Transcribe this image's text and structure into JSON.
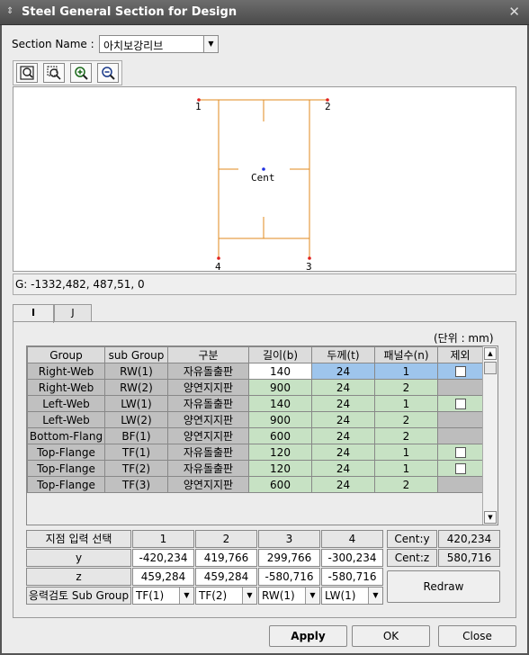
{
  "window": {
    "title": "Steel General Section for Design",
    "icon": "chevron-updown-icon",
    "close": "✕"
  },
  "section": {
    "label": "Section Name :",
    "value": "아치보강리브"
  },
  "toolbar": {
    "icons": [
      "zoom-fit-icon",
      "zoom-window-icon",
      "zoom-in-icon",
      "zoom-out-icon"
    ]
  },
  "drawing": {
    "points": [
      "1",
      "2",
      "3",
      "4"
    ],
    "center_label": "Cent",
    "line_color": "#e08a1e",
    "point_color": "#e02020",
    "center_color": "#2030e0"
  },
  "status": {
    "text": "G: -1332,482, 487,51, 0"
  },
  "tabs": [
    {
      "label": "I",
      "active": true
    },
    {
      "label": "J",
      "active": false
    }
  ],
  "unit_label": "(단위 : mm)",
  "table": {
    "headers": [
      "Group",
      "sub Group",
      "구분",
      "길이(b)",
      "두께(t)",
      "패널수(n)",
      "제외"
    ],
    "rows": [
      {
        "group": "Right-Web",
        "sub": "RW(1)",
        "kind": "자유돌출판",
        "b": "140",
        "t": "24",
        "n": "1",
        "ex": true
      },
      {
        "group": "Right-Web",
        "sub": "RW(2)",
        "kind": "양연지지판",
        "b": "900",
        "t": "24",
        "n": "2",
        "ex": false
      },
      {
        "group": "Left-Web",
        "sub": "LW(1)",
        "kind": "자유돌출판",
        "b": "140",
        "t": "24",
        "n": "1",
        "ex": true
      },
      {
        "group": "Left-Web",
        "sub": "LW(2)",
        "kind": "양연지지판",
        "b": "900",
        "t": "24",
        "n": "2",
        "ex": false
      },
      {
        "group": "Bottom-Flang",
        "sub": "BF(1)",
        "kind": "양연지지판",
        "b": "600",
        "t": "24",
        "n": "2",
        "ex": false
      },
      {
        "group": "Top-Flange",
        "sub": "TF(1)",
        "kind": "자유돌출판",
        "b": "120",
        "t": "24",
        "n": "1",
        "ex": true
      },
      {
        "group": "Top-Flange",
        "sub": "TF(2)",
        "kind": "자유돌출판",
        "b": "120",
        "t": "24",
        "n": "1",
        "ex": true
      },
      {
        "group": "Top-Flange",
        "sub": "TF(3)",
        "kind": "양연지지판",
        "b": "600",
        "t": "24",
        "n": "2",
        "ex": false
      }
    ]
  },
  "points": {
    "label": "지점 입력 선택",
    "cols": [
      "1",
      "2",
      "3",
      "4"
    ],
    "y_label": "y",
    "y": [
      "-420,234",
      "419,766",
      "299,766",
      "-300,234"
    ],
    "z_label": "z",
    "z": [
      "459,284",
      "459,284",
      "-580,716",
      "-580,716"
    ],
    "sub_label": "응력검토 Sub Group",
    "sub": [
      "TF(1)",
      "TF(2)",
      "RW(1)",
      "LW(1)"
    ]
  },
  "cent": {
    "y_label": "Cent:y",
    "y": "420,234",
    "z_label": "Cent:z",
    "z": "580,716"
  },
  "buttons": {
    "redraw": "Redraw",
    "apply": "Apply",
    "ok": "OK",
    "close": "Close"
  }
}
